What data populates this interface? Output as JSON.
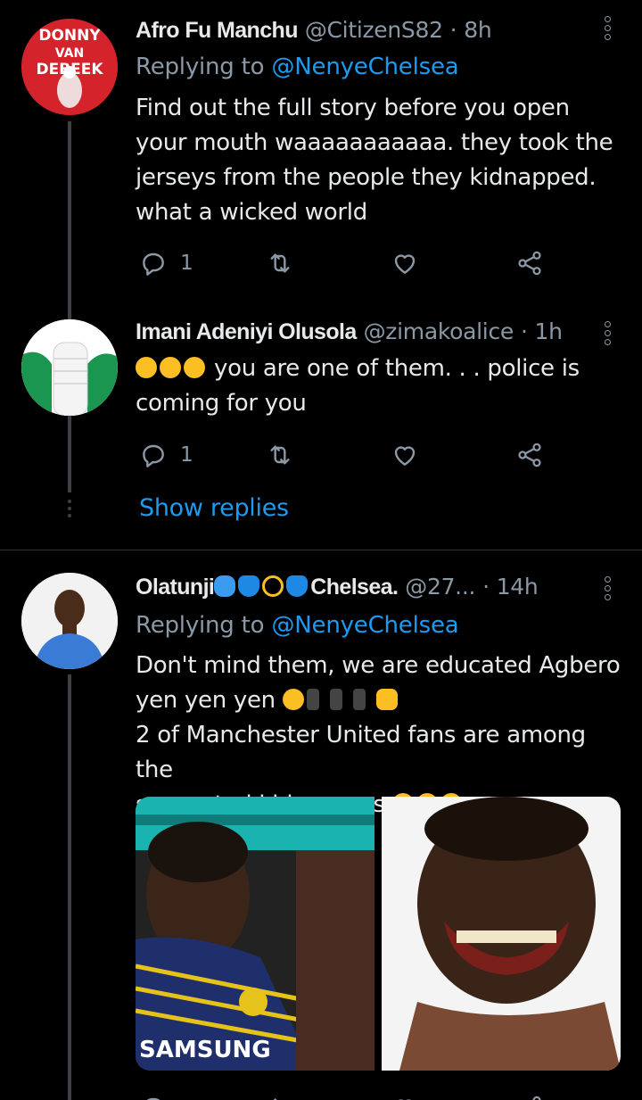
{
  "tweets": [
    {
      "avatar_text": "DONNY VAN DE BEEK",
      "name": "Afro Fu Manchu",
      "handle": "@CitizenS82",
      "separator": "·",
      "time": "8h",
      "replying_label": "Replying to",
      "replying_handle": "@NenyeChelsea",
      "text": "Find out the full story before you open your mouth waaaaaaaaaaa. they took the jerseys from the people they kidnapped. what a wicked world",
      "reply_count": "1",
      "retweet_count": "",
      "like_count": ""
    },
    {
      "name": "Imani Adeniyi Olusola",
      "handle": "@zimakoalice",
      "separator": "·",
      "time": "1h",
      "emojis": [
        "rofl-emoji",
        "rofl-emoji",
        "rofl-emoji"
      ],
      "text": "you are one of them. . . police is coming for you",
      "reply_count": "1",
      "retweet_count": "",
      "like_count": ""
    },
    {
      "name": "Olatunji",
      "name_suffix": "Chelsea.",
      "name_emojis": [
        "sweat-droplets-emoji",
        "blue-heart-emoji",
        "dizzy-emoji",
        "blue-heart-emoji"
      ],
      "handle": "@27...",
      "separator": "·",
      "time": "14h",
      "replying_label": "Replying to",
      "replying_handle": "@NenyeChelsea",
      "text_line1": "Don't mind them, we are educated Agbero",
      "text_line2": "yen yen yen",
      "text_line2_emojis": [
        "joy-emoji",
        "dancer-emoji",
        "dancer-emoji",
        "dancer-emoji",
        "thumbs-up-emoji"
      ],
      "text_line3": "2 of Manchester United fans are among the",
      "text_line4": "suspected kidnappers",
      "text_line4_emojis": [
        "joy-emoji",
        "rofl-emoji",
        "joy-emoji"
      ],
      "media": [
        {
          "kind": "photo",
          "jersey_text": "SAMSUNG"
        },
        {
          "kind": "photo"
        }
      ]
    }
  ],
  "show_replies_label": "Show replies",
  "colors": {
    "background": "#000000",
    "text": "#e7e9ea",
    "secondary": "#8b98a5",
    "accent": "#1d9bf0",
    "divider": "#2f3336"
  }
}
